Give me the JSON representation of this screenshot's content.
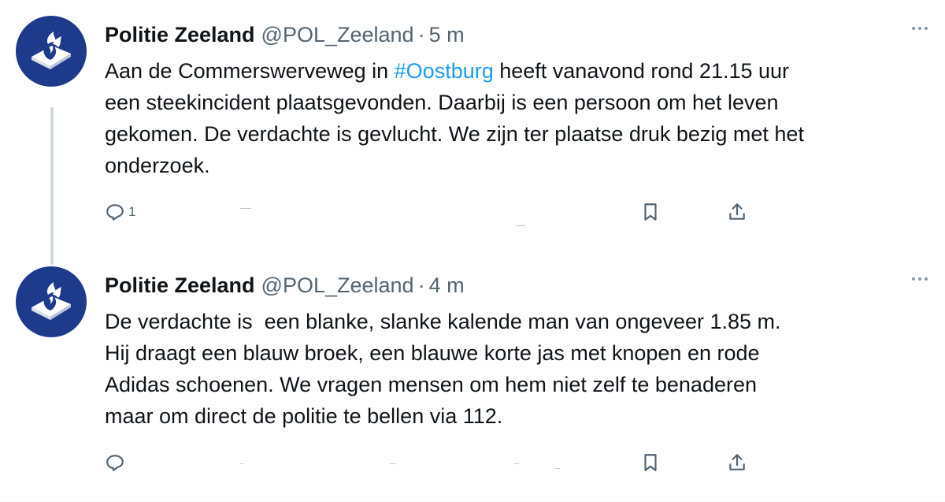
{
  "colors": {
    "brand_blue": "#1e3a8a",
    "hashtag": "#1d9bf0",
    "muted": "#536471",
    "thread_line": "#cfd9de"
  },
  "tweets": [
    {
      "author_name": "Politie Zeeland",
      "handle": "@POL_Zeeland",
      "separator": "·",
      "time": "5 m",
      "text_before": "Aan de Commerswerveweg in ",
      "hashtag": "#Oostburg",
      "text_after": " heeft vanavond rond 21.15 uur\neen steekincident plaatsgevonden. Daarbij is een persoon om het leven\ngekomen. De verdachte is gevlucht. We zijn ter plaatse druk bezig met het\nonderzoek.",
      "reply_count": "1",
      "avatar_icon": "police-flame-logo",
      "icons": [
        "more-icon",
        "reply-icon",
        "bookmark-icon",
        "share-icon"
      ]
    },
    {
      "author_name": "Politie Zeeland",
      "handle": "@POL_Zeeland",
      "separator": "·",
      "time": "4 m",
      "text": "De verdachte is  een blanke, slanke kalende man van ongeveer 1.85 m.\nHij draagt een blauw broek, een blauwe korte jas met knopen en rode\nAdidas schoenen. We vragen mensen om hem niet zelf te benaderen\nmaar om direct de politie te bellen via 112.",
      "reply_count": "",
      "avatar_icon": "police-flame-logo",
      "icons": [
        "more-icon",
        "reply-icon",
        "bookmark-icon",
        "share-icon"
      ]
    }
  ]
}
